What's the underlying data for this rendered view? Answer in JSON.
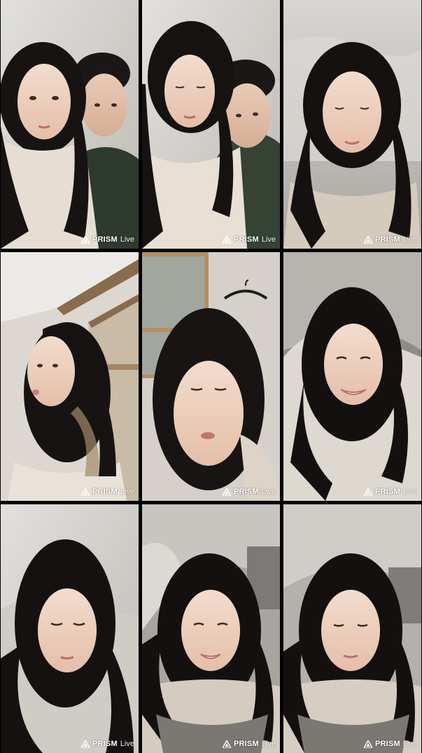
{
  "watermark": {
    "brand": "PRISM",
    "suffix": "Live",
    "icon": "prism-triangle-icon",
    "color": "#ffffff"
  },
  "tiles": [
    {
      "id": "tile-1",
      "subject": "selfie-woman-with-man",
      "bg": "#cfcdca"
    },
    {
      "id": "tile-2",
      "subject": "selfie-woman-with-man",
      "bg": "#cbc8c4"
    },
    {
      "id": "tile-3",
      "subject": "selfie-woman-in-bed",
      "bg": "#d6d4d1"
    },
    {
      "id": "tile-4",
      "subject": "selfie-woman-profile",
      "bg": "#d7d3cc"
    },
    {
      "id": "tile-5",
      "subject": "selfie-woman-closeup",
      "bg": "#cac6bf"
    },
    {
      "id": "tile-6",
      "subject": "selfie-woman-lying",
      "bg": "#b9b7b3"
    },
    {
      "id": "tile-7",
      "subject": "selfie-woman-eyes-closed",
      "bg": "#c9c6c1"
    },
    {
      "id": "tile-8",
      "subject": "selfie-woman-smiling",
      "bg": "#bdbab5"
    },
    {
      "id": "tile-9",
      "subject": "selfie-woman-lying",
      "bg": "#c3c0bb"
    }
  ]
}
